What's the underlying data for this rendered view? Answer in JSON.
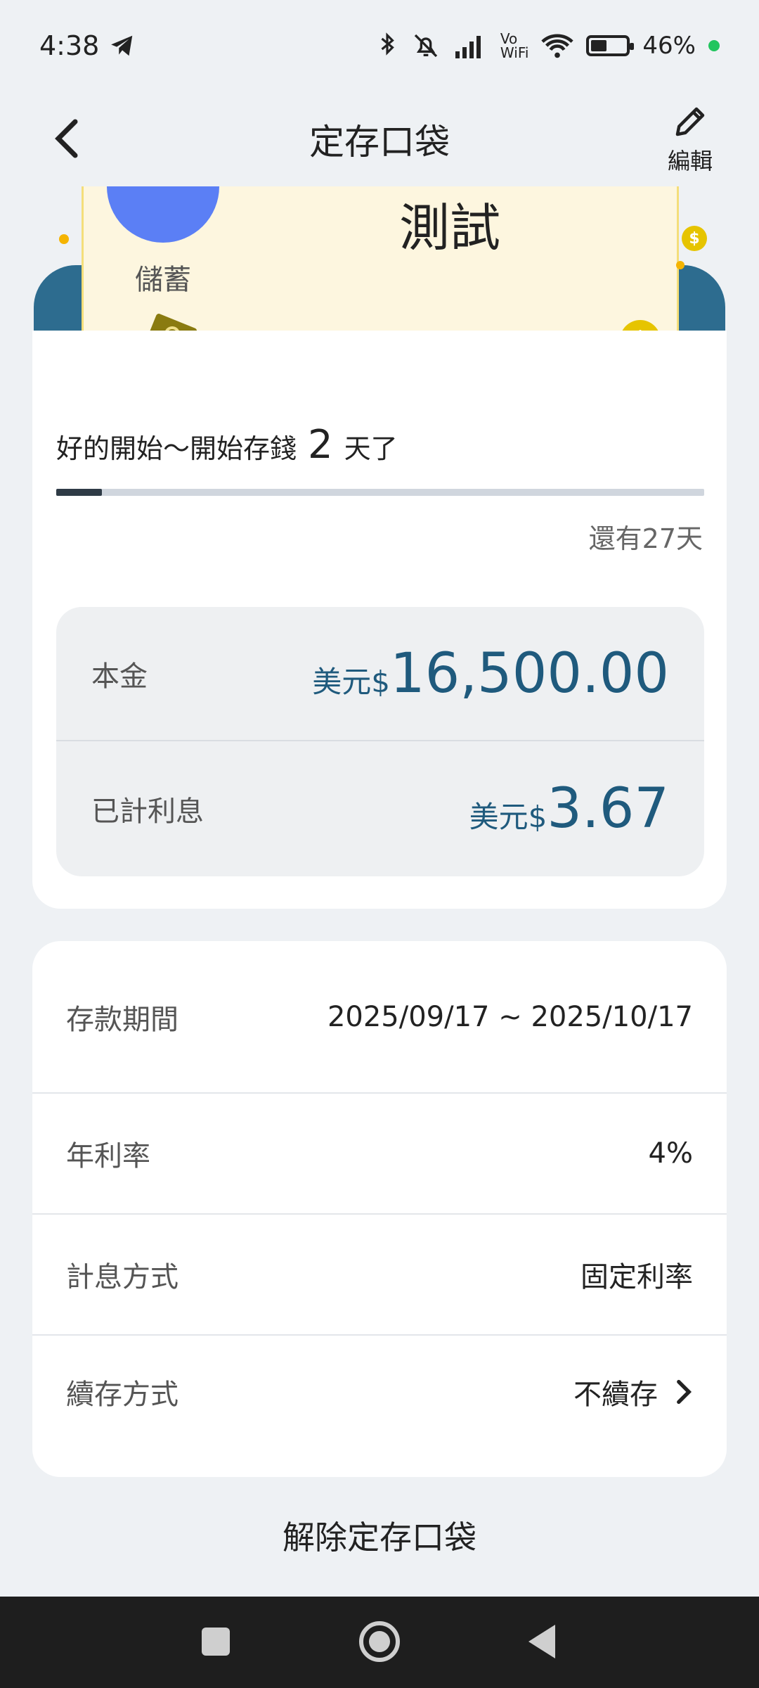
{
  "status_bar": {
    "time": "4:38",
    "network_label": "Vo\nWiFi",
    "battery_percent": "46%"
  },
  "header": {
    "title": "定存口袋",
    "edit_label": "編輯"
  },
  "banner": {
    "title": "測試",
    "category_label": "儲蓄"
  },
  "progress": {
    "prefix": "好的開始～開始存錢",
    "days": "2",
    "suffix": "天了",
    "remaining": "還有27天",
    "fraction": 0.07
  },
  "amounts": {
    "principal_label": "本金",
    "principal_currency": "美元$",
    "principal_value": "16,500.00",
    "interest_label": "已計利息",
    "interest_currency": "美元$",
    "interest_value": "3.67"
  },
  "details": {
    "period_label": "存款期間",
    "period_value": "2025/09/17 ~ 2025/10/17",
    "rate_label": "年利率",
    "rate_value": "4%",
    "method_label": "計息方式",
    "method_value": "固定利率",
    "renew_label": "續存方式",
    "renew_value": "不續存"
  },
  "actions": {
    "unlock_label": "解除定存口袋"
  },
  "colors": {
    "accent_blue": "#1f5a7d",
    "banner_bg": "#fdf6df",
    "avatar_blue": "#5b7ff5",
    "coin_yellow": "#e6c400"
  }
}
